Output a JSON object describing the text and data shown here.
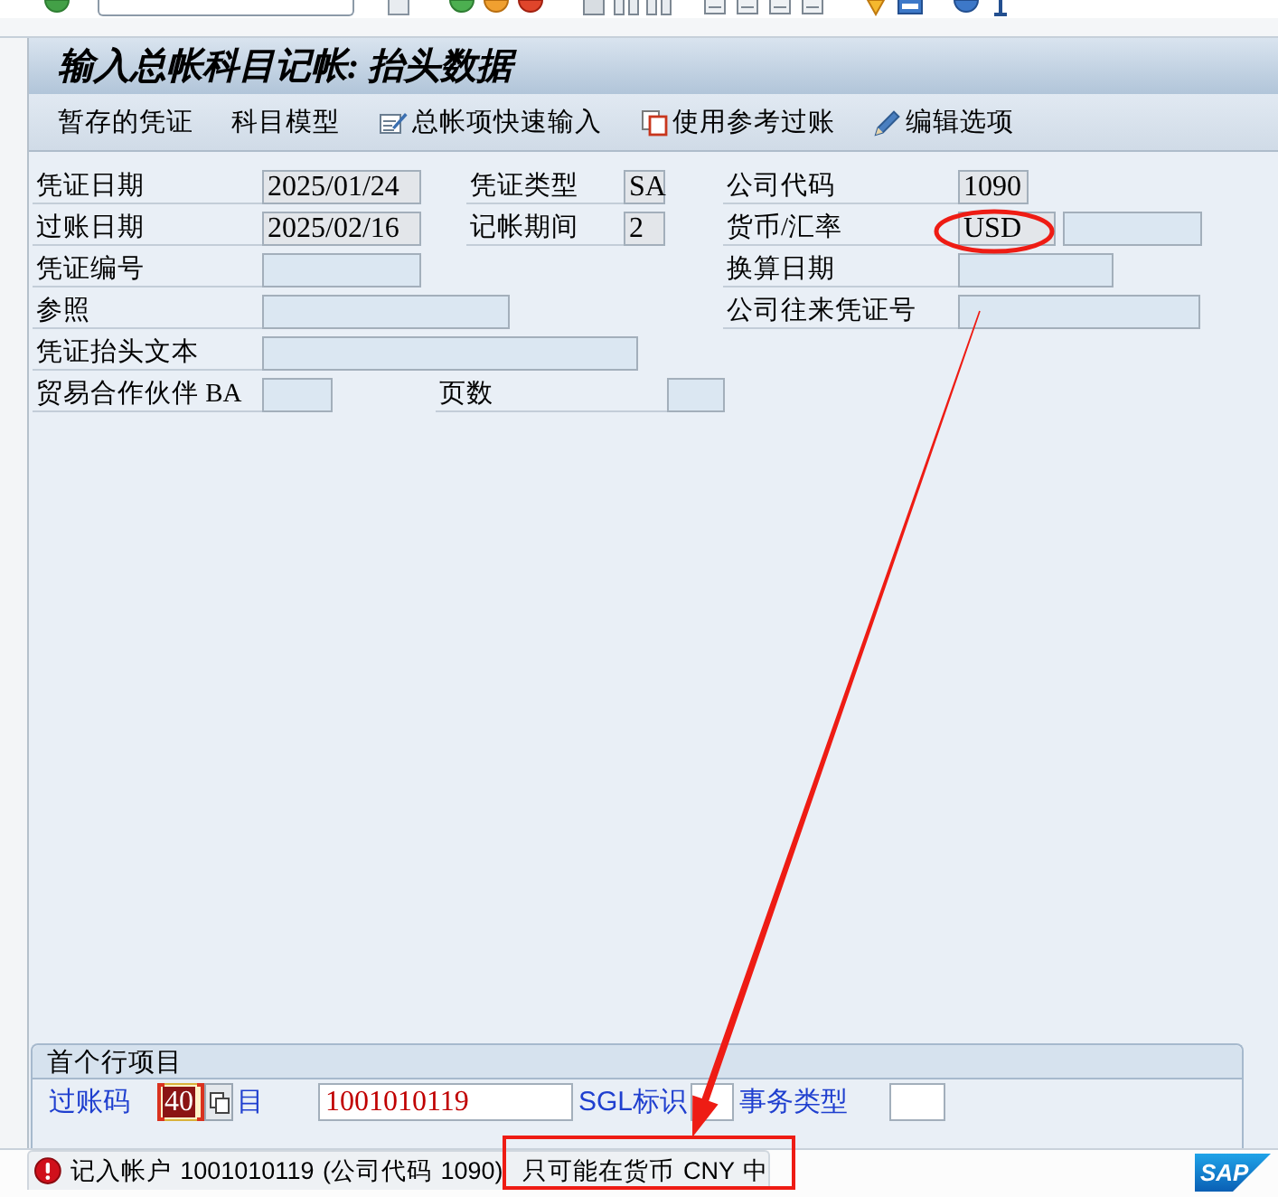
{
  "title": "输入总帐科目记帐: 抬头数据",
  "toolbar": [
    {
      "label": "暂存的凭证",
      "kind": "plain"
    },
    {
      "label": "科目模型",
      "kind": "plain"
    },
    {
      "label": "总帐项快速输入",
      "kind": "icon"
    },
    {
      "label": "使用参考过账",
      "kind": "icon"
    },
    {
      "label": "编辑选项",
      "kind": "icon"
    }
  ],
  "header": [
    [
      {
        "label": "凭证日期",
        "value": "2025/01/24"
      },
      {
        "label": "凭证类型",
        "value": "SA"
      },
      {
        "label": "公司代码",
        "value": "1090"
      }
    ],
    [
      {
        "label": "过账日期",
        "value": "2025/02/16"
      },
      {
        "label": "记帐期间",
        "value": "2"
      },
      {
        "label": "货币/汇率",
        "value": "USD"
      }
    ],
    [
      {
        "label": "凭证编号"
      },
      {
        "label": "换算日期"
      }
    ],
    [
      {
        "label": "参照"
      },
      {
        "label": "公司往来凭证号"
      }
    ],
    [
      {
        "label": "凭证抬头文本"
      }
    ],
    [
      {
        "label": "贸易合作伙伴 BA"
      },
      {
        "label": "页数"
      }
    ]
  ],
  "line_item": {
    "title": "首个行项目",
    "fields": [
      {
        "label": "过账码",
        "value": "40",
        "kind": "code",
        "selected": true,
        "error": false
      },
      {
        "label": "目",
        "value": "1001010119",
        "kind": "text",
        "selected": false,
        "error": true
      },
      {
        "label": "SGL标识",
        "kind": "text",
        "selected": false
      },
      {
        "label": "事务类型",
        "kind": "text",
        "selected": false
      }
    ]
  },
  "status_bar": {
    "message": [
      "记入帐户 1001010119 (公司代码 1090)",
      "只可能在货币 CNY 中"
    ],
    "kind": "error",
    "logo": "SAP"
  },
  "annotations": [
    {
      "kind": "ellipse"
    },
    {
      "kind": "arrow"
    },
    {
      "kind": "rectangle"
    }
  ]
}
